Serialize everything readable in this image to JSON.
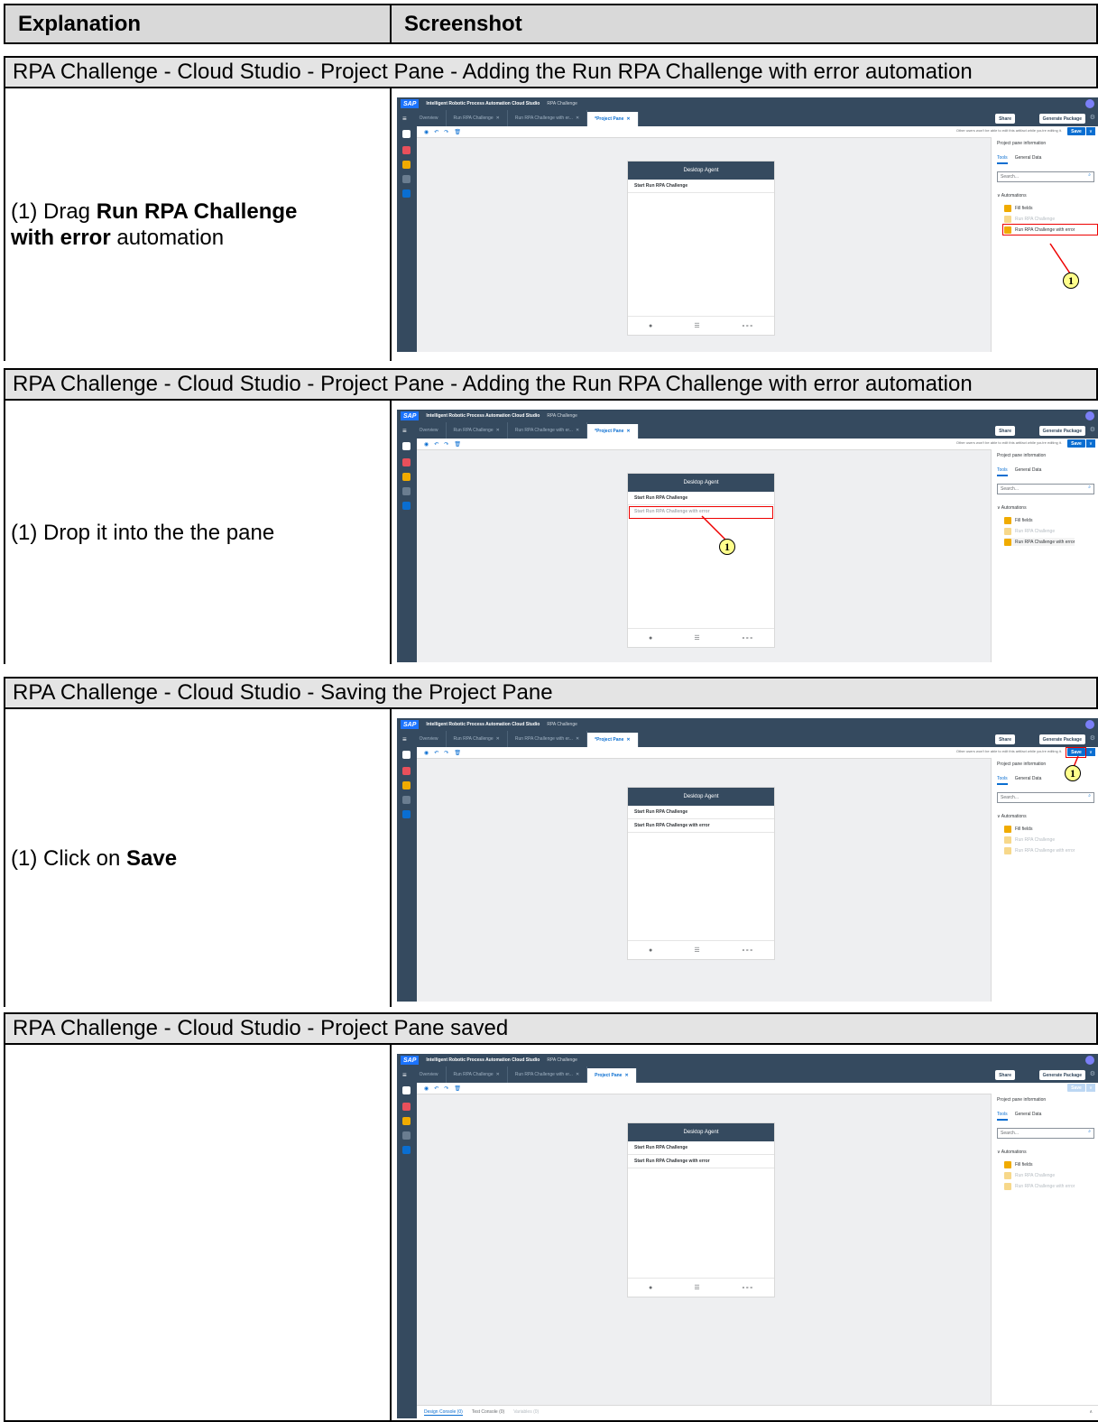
{
  "table": {
    "header_explanation": "Explanation",
    "header_screenshot": "Screenshot"
  },
  "sections": [
    {
      "title": "RPA Challenge - Cloud Studio - Project Pane - Adding the Run RPA Challenge with error automation"
    },
    {
      "title": "RPA Challenge - Cloud Studio - Project Pane - Adding the Run RPA Challenge with error automation"
    },
    {
      "title": "RPA Challenge - Cloud Studio - Saving the Project Pane"
    },
    {
      "title": "RPA Challenge - Cloud Studio - Project Pane saved"
    }
  ],
  "steps": {
    "s1": {
      "prefix": "(1) Drag ",
      "bold": "Run RPA Challenge with error",
      "suffix": " automation"
    },
    "s2": {
      "text": "(1) Drop it into the the pane"
    },
    "s3": {
      "prefix": "(1) Click on ",
      "bold": "Save"
    }
  },
  "app": {
    "logo": "SAP",
    "name": "Intelligent Robotic Process Automation Cloud Studio",
    "project": "RPA Challenge",
    "tabs": [
      "Overview",
      "Run RPA Challenge",
      "Run RPA Challenge with er...",
      "*Project Pane"
    ],
    "tab_saved": "Project Pane",
    "share": "Share",
    "generate": "Generate Package",
    "edit_msg": "Other users won't be able to edit this artifact while you're editing it.",
    "save": "Save",
    "pane_title": "Project pane information",
    "tab_tools": "Tools",
    "tab_general": "General Data",
    "search_placeholder": "Search...",
    "automations_label": "Automations",
    "automations": [
      "Fill fields",
      "Run RPA Challenge",
      "Run RPA Challenge with error"
    ],
    "agent_title": "Desktop Agent",
    "agent_row1": "Start Run RPA Challenge",
    "agent_row2": "Start Run RPA Challenge with error",
    "ghost_row": "Start Run RPA Challenge with error",
    "console_tabs": [
      "Design Console (0)",
      "Test Console (0)",
      "Variables (0)"
    ]
  },
  "callout": "1",
  "colors": {
    "shell": "#354a5f",
    "accent": "#0a6ed1",
    "highlight": "#e00000",
    "callout_fill": "#ffff8c"
  }
}
